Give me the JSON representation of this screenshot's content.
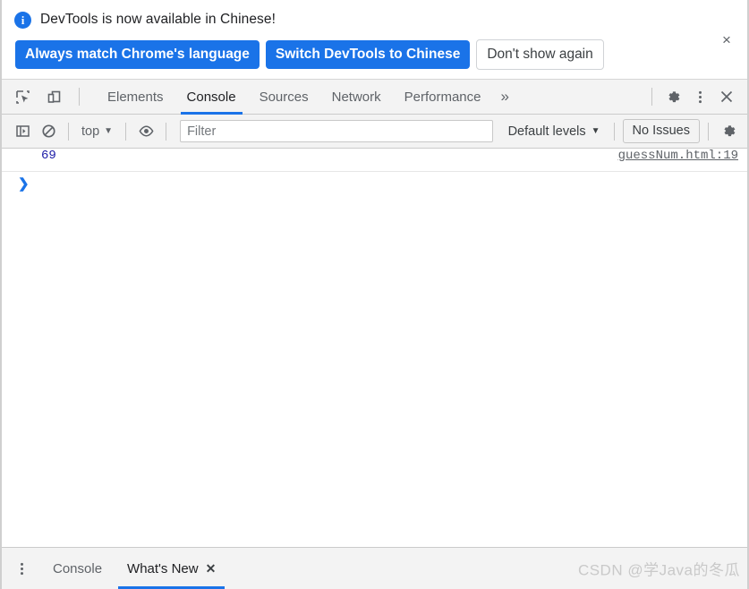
{
  "banner": {
    "icon": "info-icon",
    "message": "DevTools is now available in Chinese!",
    "primary_button_1": "Always match Chrome's language",
    "primary_button_2": "Switch DevTools to Chinese",
    "dismiss_button": "Don't show again",
    "close_label": "×",
    "accent_color": "#1a73e8"
  },
  "toolbar": {
    "inspect_icon": "inspect-element-icon",
    "device_icon": "device-toolbar-icon",
    "overflow_label": "»",
    "settings_icon": "gear-icon",
    "more_icon": "more-vertical-icon",
    "close_icon": "close-icon",
    "tabs": [
      {
        "label": "Elements",
        "active": false
      },
      {
        "label": "Console",
        "active": true
      },
      {
        "label": "Sources",
        "active": false
      },
      {
        "label": "Network",
        "active": false
      },
      {
        "label": "Performance",
        "active": false
      }
    ]
  },
  "console_toolbar": {
    "sidebar_icon": "console-sidebar-icon",
    "clear_icon": "clear-console-icon",
    "context": "top",
    "context_caret": "▼",
    "eye_icon": "live-expression-icon",
    "filter_placeholder": "Filter",
    "filter_value": "",
    "levels_label": "Default levels",
    "levels_caret": "▼",
    "issues_label": "No Issues",
    "settings_icon": "gear-icon"
  },
  "console": {
    "entries": [
      {
        "value": "69",
        "source": "guessNum.html:19"
      }
    ],
    "prompt_caret": "❯"
  },
  "drawer": {
    "menu_icon": "more-vertical-icon",
    "tabs": [
      {
        "label": "Console",
        "active": false,
        "closable": false
      },
      {
        "label": "What's New",
        "active": true,
        "closable": true
      }
    ],
    "close_label": "✕",
    "watermark": "CSDN @学Java的冬瓜"
  }
}
